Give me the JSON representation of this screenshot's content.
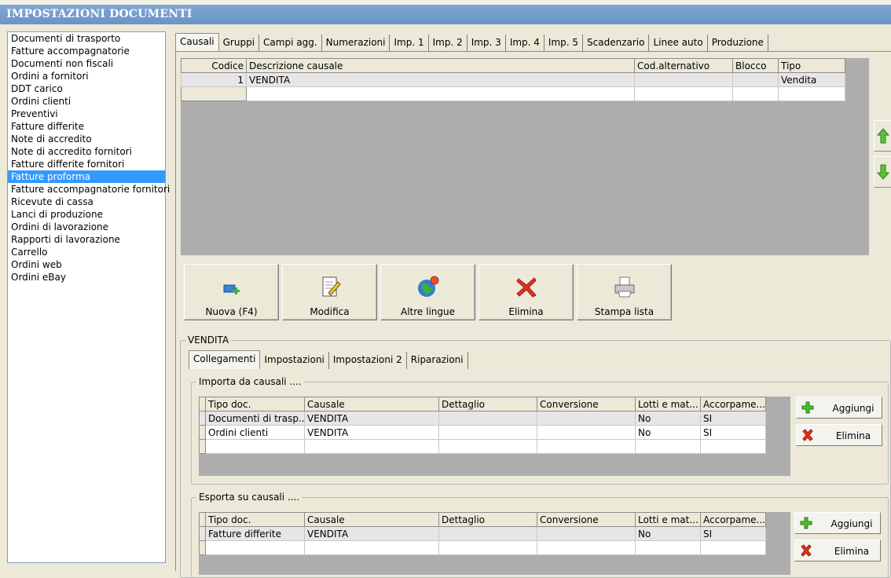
{
  "window": {
    "title": "IMPOSTAZIONI DOCUMENTI"
  },
  "doc_types": [
    "Documenti di trasporto",
    "Fatture accompagnatorie",
    "Documenti non fiscali",
    "Ordini a fornitori",
    "DDT carico",
    "Ordini clienti",
    "Preventivi",
    "Fatture differite",
    "Note di accredito",
    "Note di accredito fornitori",
    "Fatture differite fornitori",
    "Fatture proforma",
    "Fatture accompagnatorie fornitori",
    "Ricevute di cassa",
    "Lanci di produzione",
    "Ordini di lavorazione",
    "Rapporti di lavorazione",
    "Carrello",
    "Ordini web",
    "Ordini eBay"
  ],
  "selected_doc_type": "Fatture proforma",
  "main_tabs": [
    "Causali",
    "Gruppi",
    "Campi agg.",
    "Numerazioni",
    "Imp. 1",
    "Imp. 2",
    "Imp. 3",
    "Imp. 4",
    "Imp. 5",
    "Scadenzario",
    "Linee auto",
    "Produzione"
  ],
  "causali_grid": {
    "columns": [
      "Codice",
      "Descrizione causale",
      "Cod.alternativo",
      "Blocco",
      "Tipo"
    ],
    "rows": [
      [
        "1",
        "VENDITA",
        "",
        "",
        "Vendita"
      ]
    ]
  },
  "actions": {
    "new": "Nuova (F4)",
    "edit": "Modifica",
    "languages": "Altre lingue",
    "delete": "Elimina",
    "print": "Stampa lista"
  },
  "detail": {
    "group_title": "VENDITA",
    "tabs": [
      "Collegamenti",
      "Impostazioni",
      "Impostazioni 2",
      "Riparazioni"
    ],
    "import_group": {
      "title": "Importa da causali ....",
      "columns": [
        "Tipo doc.",
        "Causale",
        "Dettaglio",
        "Conversione",
        "Lotti e mat...",
        "Accorpame..."
      ],
      "rows": [
        [
          "Documenti di trasp...",
          "VENDITA",
          "",
          "",
          "No",
          "SI"
        ],
        [
          "Ordini clienti",
          "VENDITA",
          "",
          "",
          "No",
          "SI"
        ]
      ],
      "add_label": "Aggiungi",
      "delete_label": "Elimina"
    },
    "export_group": {
      "title": "Esporta su causali ....",
      "columns": [
        "Tipo doc.",
        "Causale",
        "Dettaglio",
        "Conversione",
        "Lotti e mat...",
        "Accorpame..."
      ],
      "rows": [
        [
          "Fatture differite",
          "VENDITA",
          "",
          "",
          "No",
          "SI"
        ]
      ],
      "add_label": "Aggiungi",
      "delete_label": "Elimina"
    }
  }
}
